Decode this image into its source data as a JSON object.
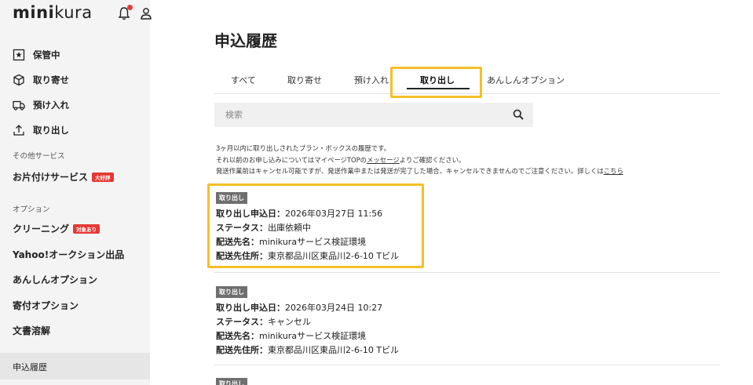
{
  "brand": {
    "logo_bold": "mini",
    "logo_thin": "kura"
  },
  "sidebar": {
    "main_items": [
      {
        "label": "保管中",
        "icon": "star-box-icon"
      },
      {
        "label": "取り寄せ",
        "icon": "box-icon"
      },
      {
        "label": "預け入れ",
        "icon": "truck-icon"
      },
      {
        "label": "取り出し",
        "icon": "upload-icon"
      }
    ],
    "other_services_label": "その他サービス",
    "tidy_service": {
      "label": "お片付けサービス",
      "badge": "大好評"
    },
    "options_label": "オプション",
    "cleaning": {
      "label": "クリーニング",
      "badge": "対象あり"
    },
    "yahoo_label": "Yahoo!オークション出品",
    "anshin_label": "あんしんオプション",
    "donation_label": "寄付オプション",
    "doc_label": "文書溶解",
    "history_label": "申込履歴"
  },
  "main": {
    "title": "申込履歴",
    "tabs": [
      {
        "label": "すべて"
      },
      {
        "label": "取り寄せ"
      },
      {
        "label": "預け入れ"
      },
      {
        "label": "取り出し"
      },
      {
        "label": "あんしんオプション"
      }
    ],
    "search": {
      "placeholder": "検索",
      "value": ""
    },
    "notice": {
      "line1": "3ヶ月以内に取り出しされたプラン・ボックスの履歴です。",
      "line2_prefix": "それ以前のお申し込みについてはマイページTOPの",
      "line2_link": "メッセージ",
      "line2_suffix": "よりご確認ください。",
      "line3_prefix": "発送作業前はキャンセル可能ですが、発送作業中または発送が完了した場合、キャンセルできませんのでご注意ください。詳しくは",
      "line3_link": "こちら"
    },
    "records": [
      {
        "badge": "取り出し",
        "date_label": "取り出し申込日：",
        "date": "2026年03月27日 11:56",
        "status_label": "ステータス：",
        "status": "出庫依頼中",
        "dest_label": "配送先名：",
        "dest": "minikuraサービス検証環境",
        "addr_label": "配送先住所：",
        "addr": "東京都品川区東品川2-6-10 Tビル"
      },
      {
        "badge": "取り出し",
        "date_label": "取り出し申込日：",
        "date": "2026年03月24日 10:27",
        "status_label": "ステータス：",
        "status": "キャンセル",
        "dest_label": "配送先名：",
        "dest": "minikuraサービス検証環境",
        "addr_label": "配送先住所：",
        "addr": "東京都品川区東品川2-6-10 Tビル"
      },
      {
        "badge": "取り出し"
      }
    ]
  },
  "colors": {
    "highlight": "#f5c026",
    "badge_red": "#e53935",
    "badge_gray": "#6f6f6f",
    "sidebar_bg": "#f4f4f4"
  }
}
